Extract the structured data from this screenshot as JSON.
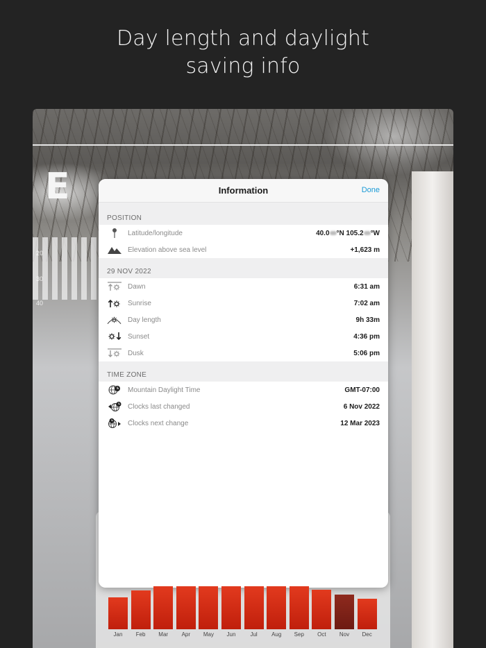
{
  "headline": [
    "Day length and daylight",
    "saving info"
  ],
  "background": {
    "compass_letter": "E",
    "scale_labels": [
      "20",
      "30",
      "40"
    ]
  },
  "modal": {
    "title": "Information",
    "done_label": "Done",
    "sections": [
      {
        "label": "POSITION",
        "rows": [
          {
            "icon": "pin-icon",
            "label": "Latitude/longitude",
            "value_parts": [
              "40.0",
              "°N 105.2",
              "°W"
            ]
          },
          {
            "icon": "mountain-icon",
            "label": "Elevation above sea level",
            "value": "+1,623 m"
          }
        ]
      },
      {
        "label": "29 NOV 2022",
        "rows": [
          {
            "icon": "dawn-icon",
            "label": "Dawn",
            "value": "6:31 am"
          },
          {
            "icon": "sunrise-icon",
            "label": "Sunrise",
            "value": "7:02 am"
          },
          {
            "icon": "day-length-icon",
            "label": "Day length",
            "value": "9h 33m"
          },
          {
            "icon": "sunset-icon",
            "label": "Sunset",
            "value": "4:36 pm"
          },
          {
            "icon": "dusk-icon",
            "label": "Dusk",
            "value": "5:06 pm"
          }
        ]
      },
      {
        "label": "TIME ZONE",
        "rows": [
          {
            "icon": "timezone-globe-icon",
            "label": "Mountain Daylight Time",
            "value": "GMT-07:00"
          },
          {
            "icon": "clocks-last-changed-icon",
            "label": "Clocks last changed",
            "value": "6 Nov 2022"
          },
          {
            "icon": "clocks-next-change-icon",
            "label": "Clocks next change",
            "value": "12 Mar 2023"
          }
        ]
      }
    ]
  },
  "chart_data": {
    "type": "bar",
    "categories": [
      "Jan",
      "Feb",
      "Mar",
      "Apr",
      "May",
      "Jun",
      "Jul",
      "Aug",
      "Sep",
      "Oct",
      "Nov",
      "Dec"
    ],
    "values": [
      0.74,
      0.9,
      1.0,
      1.0,
      1.0,
      1.0,
      1.0,
      1.0,
      1.0,
      0.92,
      0.8,
      0.71
    ],
    "highlight_category": "Nov",
    "bar_color": "#d42c14",
    "highlight_color": "#7d2218"
  }
}
